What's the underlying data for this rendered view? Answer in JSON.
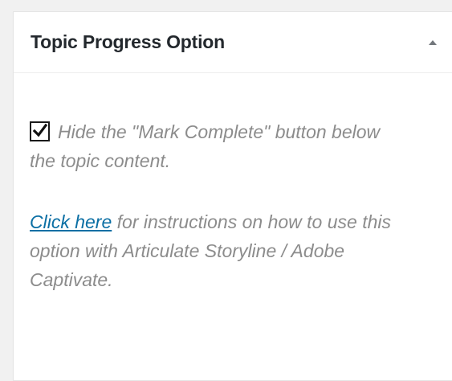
{
  "metabox": {
    "title": "Topic Progress Option",
    "toggle_icon": "triangle-up-icon"
  },
  "option": {
    "checked": true,
    "label": "Hide the \"Mark Complete\" button below the topic content."
  },
  "help": {
    "link_text": "Click here",
    "text": "for instructions on how to use this option with Articulate Storyline / Adobe Captivate."
  },
  "colors": {
    "link": "#0b6fa4",
    "muted_text": "#8c8c8c",
    "title": "#23282d"
  }
}
